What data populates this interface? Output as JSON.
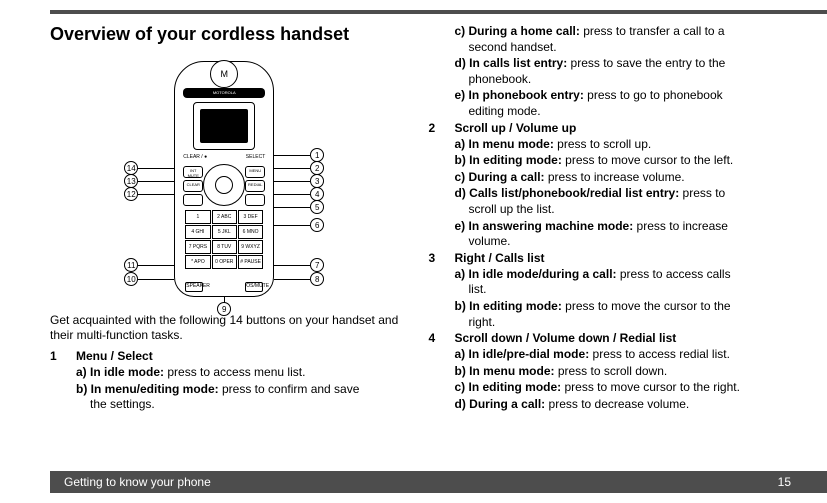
{
  "header": {
    "title": "Overview of your cordless handset"
  },
  "intro": "Get acquainted with the following 14 buttons on your handset and their multi-function tasks.",
  "handset": {
    "logo": "M",
    "brand": "MOTOROLA",
    "soft_left": "CLEAR / ●",
    "soft_right": "SELECT",
    "callouts": [
      "1",
      "2",
      "3",
      "4",
      "5",
      "6",
      "7",
      "8",
      "9",
      "10",
      "11",
      "12",
      "13",
      "14"
    ],
    "side_left": [
      "INT MUTE",
      "CLEAR",
      ""
    ],
    "side_right": [
      "MENU",
      "REDIAL",
      ""
    ],
    "keys": [
      "1",
      "2 ABC",
      "3 DEF",
      "4 GHI",
      "5 JKL",
      "6 MNO",
      "7 PQRS",
      "8 TUV",
      "9 WXYZ",
      "* APO",
      "0 OPER",
      "# PAUSE"
    ],
    "bottom_left": "SPEAKER",
    "bottom_right": "OS/MUTE"
  },
  "left_items": [
    {
      "num": "1",
      "title": "Menu / Select",
      "subs": [
        {
          "b": "a) In idle mode:",
          "t": " press to access menu list."
        },
        {
          "b": "b) In menu/editing mode:",
          "t": " press to confirm and save",
          "cont": "the  settings."
        }
      ]
    }
  ],
  "right_items_pre": [
    {
      "b": "c) During a home call:",
      "t": " press to transfer a call to a",
      "cont": "second handset."
    },
    {
      "b": "d) In calls list entry:",
      "t": " press to save the entry to the",
      "cont": "phonebook."
    },
    {
      "b": "e) In phonebook entry:",
      "t": " press to go to phonebook",
      "cont": "editing mode."
    }
  ],
  "right_items": [
    {
      "num": "2",
      "title": "Scroll up / Volume up",
      "subs": [
        {
          "b": "a) In menu mode:",
          "t": " press to scroll up."
        },
        {
          "b": "b) In editing mode:",
          "t": " press to move cursor to the left."
        },
        {
          "b": "c) During a call:",
          "t": " press to increase volume."
        },
        {
          "b": "d) Calls list/phonebook/redial list entry:",
          "t": " press to",
          "cont": "scroll up the list."
        },
        {
          "b": "e) In answering machine mode:",
          "t": " press to increase",
          "cont": "volume."
        }
      ]
    },
    {
      "num": "3",
      "title": "Right / Calls list",
      "subs": [
        {
          "b": "a) In idle mode/during a call:",
          "t": " press to access calls",
          "cont": "list."
        },
        {
          "b": "b) In editing mode:",
          "t": " press to move the cursor to the",
          "cont": "right."
        }
      ]
    },
    {
      "num": "4",
      "title": "Scroll down / Volume down / Redial list",
      "subs": [
        {
          "b": "a) In idle/pre-dial mode:",
          "t": " press to access redial list."
        },
        {
          "b": "b) In menu mode:",
          "t": " press to scroll down."
        },
        {
          "b": "c) In editing mode:",
          "t": " press to move cursor to the right."
        },
        {
          "b": "d) During a call:",
          "t": " press to decrease volume."
        }
      ]
    }
  ],
  "footer": {
    "section": "Getting to know your phone",
    "page": "15"
  }
}
